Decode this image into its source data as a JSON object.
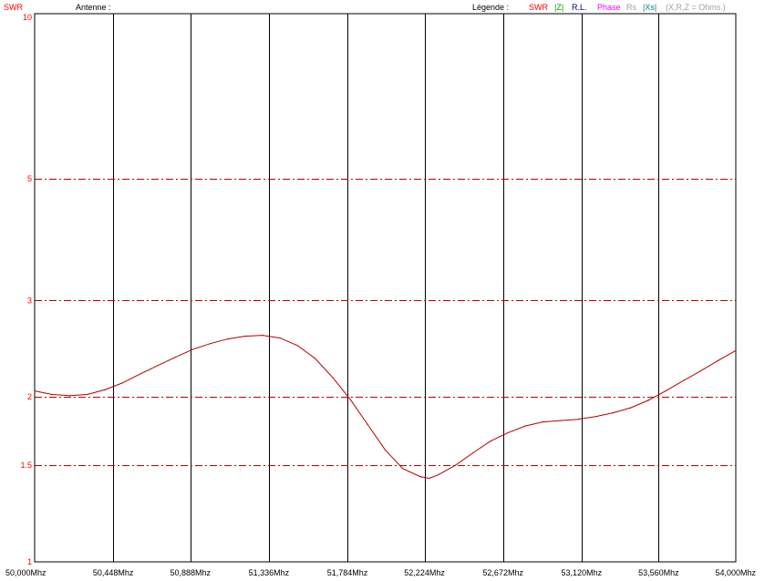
{
  "header": {
    "y_axis_label": "SWR",
    "antenna_label": "Antenne :",
    "legend_label": "Légende :",
    "legend": [
      {
        "text": "SWR",
        "color": "#ff0000"
      },
      {
        "text": "|Z|",
        "color": "#00a000"
      },
      {
        "text": "R.L.",
        "color": "#000080"
      },
      {
        "text": "Phase",
        "color": "#ff00ff"
      },
      {
        "text": "Rs",
        "color": "#a0a0a0"
      },
      {
        "text": "|Xs|",
        "color": "#008080"
      },
      {
        "text": "(X,R,Z = Ohms.)",
        "color": "#a0a0a0"
      }
    ]
  },
  "colors": {
    "curve": "#b00000",
    "h_grid": "#c00000",
    "v_grid": "#000000"
  },
  "chart_data": {
    "type": "line",
    "title": "",
    "xlabel": "",
    "ylabel": "SWR",
    "x_unit": "Mhz",
    "xlim": [
      50.0,
      54.0
    ],
    "ylim": [
      1,
      10
    ],
    "y_scale": "log",
    "x_ticks": [
      {
        "value": 50.0,
        "label": "50,000Mhz"
      },
      {
        "value": 50.448,
        "label": "50,448Mhz"
      },
      {
        "value": 50.888,
        "label": "50,888Mhz"
      },
      {
        "value": 51.336,
        "label": "51,336Mhz"
      },
      {
        "value": 51.784,
        "label": "51,784Mhz"
      },
      {
        "value": 52.224,
        "label": "52,224Mhz"
      },
      {
        "value": 52.672,
        "label": "52,672Mhz"
      },
      {
        "value": 53.12,
        "label": "53,120Mhz"
      },
      {
        "value": 53.56,
        "label": "53,560Mhz"
      },
      {
        "value": 54.0,
        "label": "54,000Mhz"
      }
    ],
    "y_ticks": [
      {
        "value": 10,
        "label": "10"
      },
      {
        "value": 5,
        "label": "5"
      },
      {
        "value": 3,
        "label": "3"
      },
      {
        "value": 2,
        "label": "2"
      },
      {
        "value": 1.5,
        "label": "1.5"
      },
      {
        "value": 1,
        "label": "1"
      }
    ],
    "grid": true,
    "series": [
      {
        "name": "SWR",
        "x": [
          50.0,
          50.1,
          50.2,
          50.3,
          50.4,
          50.5,
          50.6,
          50.7,
          50.8,
          50.9,
          51.0,
          51.1,
          51.2,
          51.3,
          51.4,
          51.5,
          51.6,
          51.7,
          51.8,
          51.9,
          52.0,
          52.1,
          52.2,
          52.25,
          52.3,
          52.4,
          52.5,
          52.6,
          52.7,
          52.8,
          52.9,
          53.0,
          53.1,
          53.2,
          53.3,
          53.4,
          53.5,
          53.6,
          53.7,
          53.8,
          53.9,
          54.0
        ],
        "y": [
          2.05,
          2.02,
          2.01,
          2.02,
          2.06,
          2.12,
          2.2,
          2.28,
          2.36,
          2.44,
          2.5,
          2.55,
          2.58,
          2.59,
          2.56,
          2.48,
          2.35,
          2.17,
          1.98,
          1.78,
          1.6,
          1.48,
          1.43,
          1.42,
          1.44,
          1.5,
          1.58,
          1.66,
          1.72,
          1.77,
          1.8,
          1.81,
          1.82,
          1.84,
          1.87,
          1.91,
          1.97,
          2.05,
          2.14,
          2.23,
          2.33,
          2.43
        ]
      }
    ]
  }
}
